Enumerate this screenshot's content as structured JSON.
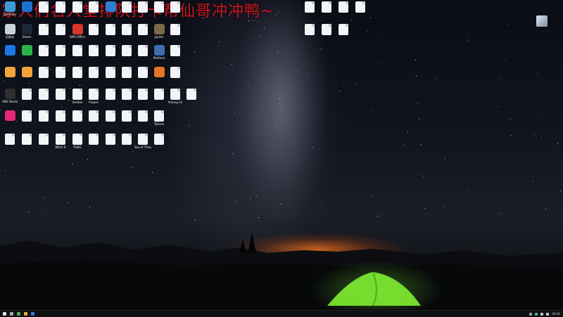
{
  "overlay": {
    "title": "家人们名人堂排队打卡帮仙哥冲冲鸭~"
  },
  "desktop": {
    "icons": [
      {
        "label": "Defender",
        "color": "#3a9bd8"
      },
      {
        "label": "",
        "color": "#1f6fd1"
      },
      {
        "label": "",
        "color": "#f2f4f7"
      },
      {
        "label": "",
        "color": "#f2f4f7"
      },
      {
        "label": "",
        "color": "#f2f4f7"
      },
      {
        "label": "",
        "color": "#f2f4f7"
      },
      {
        "label": "",
        "color": "#2e7fd4"
      },
      {
        "label": "",
        "color": "#f2f4f7"
      },
      {
        "label": "",
        "color": "#f2f4f7"
      },
      {
        "label": "",
        "color": "#f2f4f7"
      },
      {
        "label": "",
        "color": "#f2f4f7"
      },
      {
        "label": "回收站",
        "color": "#c9d2dc"
      },
      {
        "label": "Steam",
        "color": "#1b2838"
      },
      {
        "label": "",
        "color": "#f2f4f7"
      },
      {
        "label": "",
        "color": "#f2f4f7"
      },
      {
        "label": "WPS Office",
        "color": "#d9342b"
      },
      {
        "label": "",
        "color": "#f2f4f7"
      },
      {
        "label": "",
        "color": "#f2f4f7"
      },
      {
        "label": "",
        "color": "#f2f4f7"
      },
      {
        "label": "",
        "color": "#f2f4f7"
      },
      {
        "label": "Jupiter",
        "color": "#7a6a4a"
      },
      {
        "label": "",
        "color": "#f2f4f7"
      },
      {
        "label": "",
        "color": "#1a79e0"
      },
      {
        "label": "",
        "color": "#2bb24c"
      },
      {
        "label": "",
        "color": "#f2f4f7"
      },
      {
        "label": "",
        "color": "#f2f4f7"
      },
      {
        "label": "",
        "color": "#f2f4f7"
      },
      {
        "label": "",
        "color": "#f2f4f7"
      },
      {
        "label": "",
        "color": "#f2f4f7"
      },
      {
        "label": "",
        "color": "#f2f4f7"
      },
      {
        "label": "",
        "color": "#f2f4f7"
      },
      {
        "label": "Platform",
        "color": "#3d6fb0"
      },
      {
        "label": "",
        "color": "#f2f4f7"
      },
      {
        "label": "",
        "color": "#f2a53b"
      },
      {
        "label": "",
        "color": "#f2a53b"
      },
      {
        "label": "",
        "color": "#f2f4f7"
      },
      {
        "label": "",
        "color": "#f2f4f7"
      },
      {
        "label": "",
        "color": "#f2f4f7"
      },
      {
        "label": "",
        "color": "#f2f4f7"
      },
      {
        "label": "",
        "color": "#f2f4f7"
      },
      {
        "label": "",
        "color": "#f2f4f7"
      },
      {
        "label": "",
        "color": "#f2f4f7"
      },
      {
        "label": "",
        "color": "#e8732a"
      },
      {
        "label": "",
        "color": "#f2f4f7"
      },
      {
        "label": "OBS Studio",
        "color": "#302e31"
      },
      {
        "label": "",
        "color": "#f2f4f7"
      },
      {
        "label": "",
        "color": "#f2f4f7"
      },
      {
        "label": "",
        "color": "#f2f4f7"
      },
      {
        "label": "SeeSee",
        "color": "#f2f4f7"
      },
      {
        "label": "Project",
        "color": "#f2f4f7"
      },
      {
        "label": "",
        "color": "#f2f4f7"
      },
      {
        "label": "",
        "color": "#f2f4f7"
      },
      {
        "label": "",
        "color": "#f2f4f7"
      },
      {
        "label": "",
        "color": "#f2f4f7"
      },
      {
        "label": "Among Us",
        "color": "#f2f4f7"
      },
      {
        "label": "",
        "color": "#f2f4f7"
      },
      {
        "label": "",
        "color": "#e4287a"
      },
      {
        "label": "",
        "color": "#f2f4f7"
      },
      {
        "label": "",
        "color": "#f2f4f7"
      },
      {
        "label": "",
        "color": "#f2f4f7"
      },
      {
        "label": "",
        "color": "#f2f4f7"
      },
      {
        "label": "",
        "color": "#f2f4f7"
      },
      {
        "label": "",
        "color": "#f2f4f7"
      },
      {
        "label": "",
        "color": "#f2f4f7"
      },
      {
        "label": "",
        "color": "#f2f4f7"
      },
      {
        "label": "ToDesk",
        "color": "#f2f4f7"
      },
      {
        "label": "",
        "color": "#f2f4f7"
      },
      {
        "label": "",
        "color": "#f2f4f7"
      },
      {
        "label": "",
        "color": "#f2f4f7"
      },
      {
        "label": "Witch It",
        "color": "#f2f4f7"
      },
      {
        "label": "PUBG",
        "color": "#f2f4f7"
      },
      {
        "label": "",
        "color": "#f2f4f7"
      },
      {
        "label": "",
        "color": "#f2f4f7"
      },
      {
        "label": "",
        "color": "#f2f4f7"
      },
      {
        "label": "Sea of Thieves",
        "color": "#f2f4f7"
      },
      {
        "label": "",
        "color": "#f2f4f7"
      }
    ],
    "top_right_icons": [
      {
        "label": "",
        "color": "#f2f4f7"
      },
      {
        "label": "",
        "color": "#f2f4f7"
      },
      {
        "label": "",
        "color": "#f2f4f7"
      },
      {
        "label": "",
        "color": "#f2f4f7"
      },
      {
        "label": "",
        "color": "#f2f4f7"
      },
      {
        "label": "",
        "color": "#f2f4f7"
      },
      {
        "label": "",
        "color": "#f2f4f7"
      }
    ]
  },
  "taskbar": {
    "clock": "20:04"
  }
}
